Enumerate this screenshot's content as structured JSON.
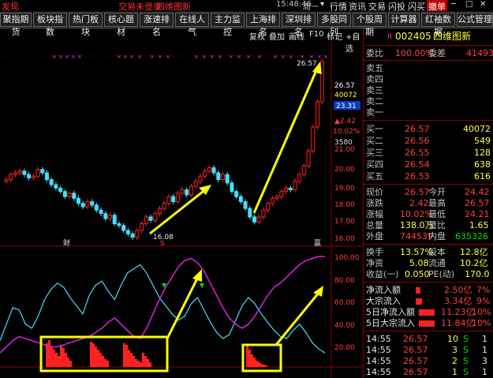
{
  "topbar": {
    "app_label": "发现",
    "login": "交易未登录",
    "stock_title": "四维图新",
    "clock": "15:48:46",
    "weekday": "周一",
    "menu": [
      "行情",
      "资讯",
      "交易",
      "闪投",
      "闪买",
      "撤单"
    ],
    "active_menu": "撤单"
  },
  "tabs": [
    "聚指期货",
    "板块指数",
    "热门板块",
    "核心题材",
    "涨速排名",
    "在线人气",
    "主力监控",
    "上海排名",
    "深圳排名",
    "多股同列",
    "个股周期",
    "计算器",
    "红袖数据",
    "公式管理"
  ],
  "chart_tools": [
    "复权",
    "叠加",
    "画线",
    "F10",
    "标记",
    "+自选"
  ],
  "chart": {
    "price_axis": [
      "26.57",
      "40072",
      "23.31",
      "▲2.42",
      "10.02%",
      "3580",
      "21.00",
      "20.00",
      "19.00",
      "18.00",
      "17.00",
      "16.00"
    ],
    "high_label": "26.57",
    "low_label": "16.08",
    "indicator_axis": [
      "100.00",
      "80.00",
      "60.00",
      "40.00",
      "20.00"
    ],
    "markers": [
      "财",
      "S",
      "赢"
    ],
    "colors": {
      "up": "#ff2020",
      "down": "#40e0ff",
      "arrow": "#ffff00",
      "k": "#40e0ff",
      "d": "#e020e0"
    }
  },
  "panel": {
    "header_r": "R",
    "code": "002405",
    "name": "四维图新",
    "weibi_label": "委比",
    "weibi_value": "100.00%",
    "weicha_label": "委差",
    "weicha_value": "41493",
    "asks": [
      {
        "label": "卖五",
        "price": "",
        "vol": ""
      },
      {
        "label": "卖四",
        "price": "",
        "vol": ""
      },
      {
        "label": "卖三",
        "price": "",
        "vol": ""
      },
      {
        "label": "卖二",
        "price": "",
        "vol": ""
      },
      {
        "label": "卖一",
        "price": "",
        "vol": ""
      }
    ],
    "bids": [
      {
        "label": "买一",
        "price": "26.57",
        "vol": "40072"
      },
      {
        "label": "买二",
        "price": "26.56",
        "vol": "549"
      },
      {
        "label": "买三",
        "price": "26.55",
        "vol": "128"
      },
      {
        "label": "买四",
        "price": "26.54",
        "vol": "638"
      },
      {
        "label": "买五",
        "price": "26.53",
        "vol": "616"
      }
    ],
    "stats": [
      {
        "l1": "现价",
        "v1": "26.57",
        "l2": "今开",
        "v2": "24.42"
      },
      {
        "l1": "涨跌",
        "v1": "2.42",
        "l2": "最高",
        "v2": "26.57"
      },
      {
        "l1": "涨幅",
        "v1": "10.02%",
        "l2": "最低",
        "v2": "24.21"
      },
      {
        "l1": "总量",
        "v1": "138.0万",
        "l2": "量比",
        "v2": "1.65"
      },
      {
        "l1": "外盘",
        "v1": "744539",
        "l2": "内盘",
        "v2": "635326"
      }
    ],
    "stats2": [
      {
        "l1": "换手",
        "v1": "13.57%",
        "l2": "股本",
        "v2": "12.8亿"
      },
      {
        "l1": "净资",
        "v1": "5.08",
        "l2": "流通",
        "v2": "10.2亿"
      },
      {
        "l1": "收益(一)",
        "v1": "0.050",
        "l2": "PE(动)",
        "v2": "170.0"
      }
    ],
    "flows": [
      {
        "label": "净流入额",
        "value": "2.50亿",
        "pct": "7%"
      },
      {
        "label": "大宗流入",
        "value": "3.34亿",
        "pct": "9%"
      },
      {
        "label": "5日净流入额",
        "value": "11.23亿",
        "pct": "10%"
      },
      {
        "label": "5日大宗流入",
        "value": "11.84亿",
        "pct": "10%"
      }
    ],
    "ticks": [
      {
        "time": "14:55",
        "price": "26.57",
        "vol": "10",
        "side": "S",
        "n": "1"
      },
      {
        "time": "14:55",
        "price": "26.57",
        "vol": "3",
        "side": "S",
        "n": "1"
      },
      {
        "time": "14:55",
        "price": "26.57",
        "vol": "2",
        "side": "S",
        "n": "3"
      },
      {
        "time": "14:55",
        "price": "26.57",
        "vol": "1",
        "side": "S",
        "n": "1"
      }
    ]
  }
}
